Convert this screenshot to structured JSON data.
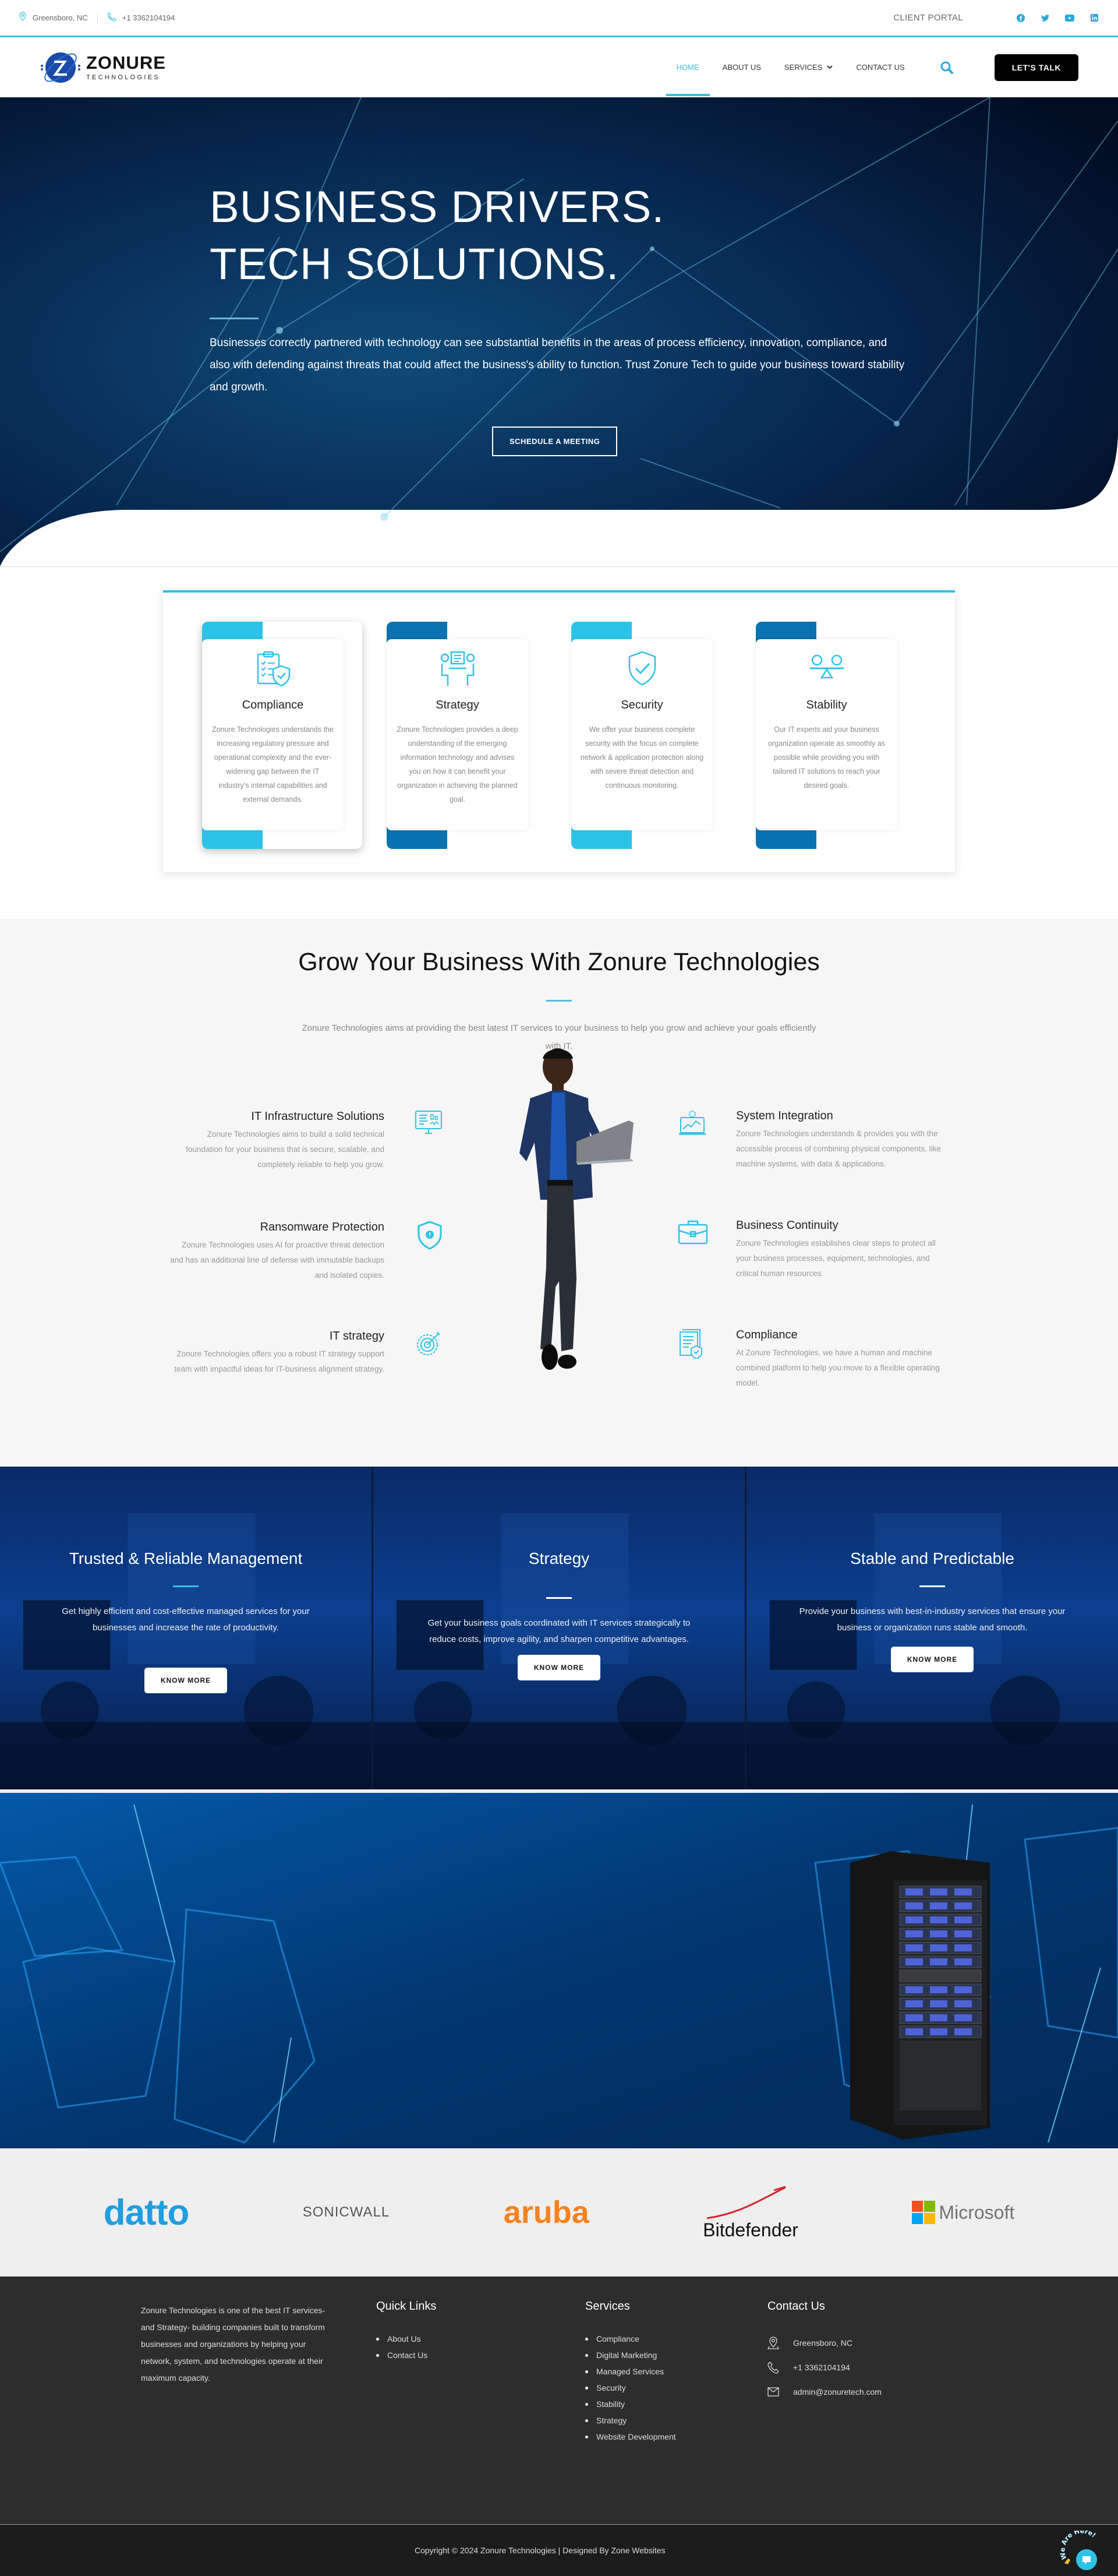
{
  "topbar": {
    "location": "Greensboro, NC",
    "phone": "+1 3362104194",
    "client_portal": "CLIENT PORTAL",
    "social": [
      "facebook-icon",
      "twitter-icon",
      "youtube-icon",
      "linkedin-icon"
    ]
  },
  "nav": {
    "logo_main": "ZONURE",
    "logo_sub": "TECHNOLOGIES",
    "items": [
      {
        "label": "HOME",
        "active": true
      },
      {
        "label": "ABOUT US"
      },
      {
        "label": "SERVICES",
        "dropdown": true
      },
      {
        "label": "CONTACT US"
      }
    ],
    "cta": "LET'S TALK"
  },
  "hero": {
    "title": "BUSINESS DRIVERS. TECH SOLUTIONS.",
    "text": "Businesses correctly partnered with technology can see substantial benefits in the areas of process efficiency, innovation, compliance, and also with defending against threats that could affect the business's ability to function. Trust Zonure Tech to guide your business toward stability and growth.",
    "button": "SCHEDULE A MEETING"
  },
  "features": [
    {
      "title": "Compliance",
      "icon": "clipboard-shield-icon",
      "text": "Zonure Technologies understands the increasing regulatory pressure and operational complexity and the ever-widening gap between the IT industry's internal capabilities and external demands."
    },
    {
      "title": "Strategy",
      "icon": "meeting-icon",
      "text": "Zonure Technologies provides a deep understanding of the emerging information technology and advises you on how it can benefit your organization in achieving the planned goal."
    },
    {
      "title": "Security",
      "icon": "shield-check-icon",
      "text": "We offer your business complete security with the focus on complete network & application protection along with severe threat detection and continuous monitoring."
    },
    {
      "title": "Stability",
      "icon": "balance-icon",
      "text": "Our IT experts aid your business organization operate as smoothly as possible while providing you with tailored IT solutions to reach your desired goals."
    }
  ],
  "grow": {
    "title": "Grow Your Business With Zonure Technologies",
    "intro": "Zonure Technologies aims at providing the best latest IT services to your business to help you grow and achieve your goals efficiently with IT.",
    "left": [
      {
        "title": "IT Infrastructure Solutions",
        "icon": "monitor-dashboard-icon",
        "text": "Zonure Technologies aims to build a solid technical foundation for your business that is secure, scalable, and completely reliable to help you grow."
      },
      {
        "title": "Ransomware Protection",
        "icon": "shield-alert-icon",
        "text": "Zonure Technologies uses AI for proactive threat detection and has an additional line of defense with immutable backups and isolated copies."
      },
      {
        "title": "IT strategy",
        "icon": "target-icon",
        "text": "Zonure Technologies offers you a robust IT strategy support team with impactful ideas for IT-business alignment strategy."
      }
    ],
    "right": [
      {
        "title": "System Integration",
        "icon": "laptop-gear-icon",
        "text": "Zonure Technologies understands & provides you with the accessible process of combining physical components, like machine systems, with data & applications."
      },
      {
        "title": "Business Continuity",
        "icon": "briefcase-icon",
        "text": "Zonure Technologies establishes clear steps to protect all your business processes, equipment, technologies, and critical human resources."
      },
      {
        "title": "Compliance",
        "icon": "document-shield-icon",
        "text": "At Zonure Technologies, we have a human and machine combined platform to help you move to a flexible operating model."
      }
    ]
  },
  "tiles": [
    {
      "title": "Trusted & Reliable Management",
      "text": "Get highly efficient and cost-effective managed services for your businesses and increase the rate of productivity.",
      "button": "KNOW MORE",
      "line_color": "#3cc0e6"
    },
    {
      "title": "Strategy",
      "text": "Get your business goals coordinated with IT services strategically to reduce costs, improve agility, and sharpen competitive advantages.",
      "button": "KNOW MORE",
      "line_color": "#ffffff"
    },
    {
      "title": "Stable and Predictable",
      "text": "Provide your business with best-in-industry services that ensure your business or organization runs stable and smooth.",
      "button": "KNOW MORE",
      "line_color": "#ffffff"
    }
  ],
  "partners": [
    "datto",
    "SONICWALL",
    "aruba",
    "Bitdefender",
    "Microsoft"
  ],
  "footer": {
    "about": "Zonure Technologies is one of the best IT services- and Strategy- building companies built to transform businesses and organizations by helping your network, system, and technologies operate at their maximum capacity.",
    "quick_title": "Quick Links",
    "quick_links": [
      "About Us",
      "Contact Us"
    ],
    "services_title": "Services",
    "services": [
      "Compliance",
      "Digital Marketing",
      "Managed Services",
      "Security",
      "Stability",
      "Strategy",
      "Website Development"
    ],
    "contact_title": "Contact Us",
    "contact": {
      "location": "Greensboro, NC",
      "phone": "+1 3362104194",
      "email": "admin@zonuretech.com"
    },
    "copyright": "Copyright © 2024 Zonure Technologies | Designed By Zone Websites",
    "chat_label": "We Are Here!"
  },
  "colors": {
    "accent": "#39bfdc",
    "dark_blue": "#0a72b1",
    "light_blue": "#2dc3e8",
    "footer_bg": "#2d2d2d"
  }
}
